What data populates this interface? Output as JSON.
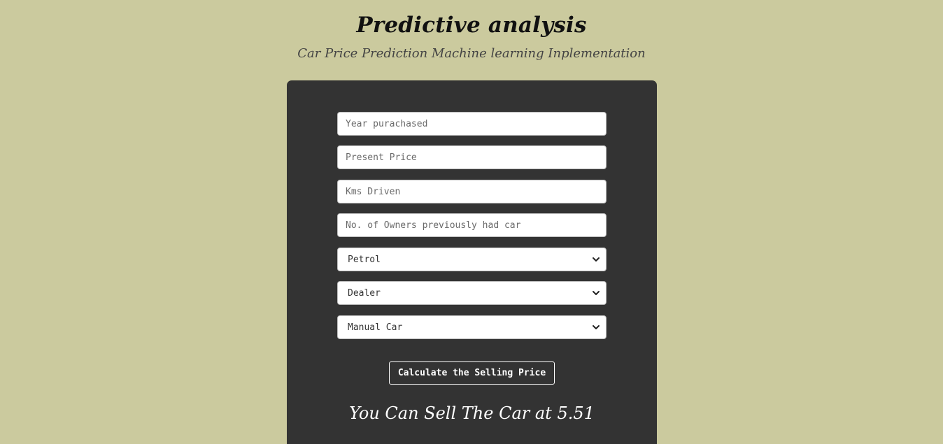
{
  "header": {
    "title": "Predictive analysis",
    "subtitle": "Car Price Prediction Machine learning Inplementation"
  },
  "form": {
    "year_placeholder": "Year purachased",
    "present_price_placeholder": "Present Price",
    "kms_placeholder": "Kms Driven",
    "owners_placeholder": "No. of Owners previously had car",
    "fuel_type": "Petrol",
    "seller_type": "Dealer",
    "transmission": "Manual Car",
    "submit_label": "Calculate the Selling Price"
  },
  "result": {
    "text": "You Can Sell The Car at 5.51"
  },
  "colors": {
    "background": "#cbca9e",
    "panel": "#333333"
  }
}
